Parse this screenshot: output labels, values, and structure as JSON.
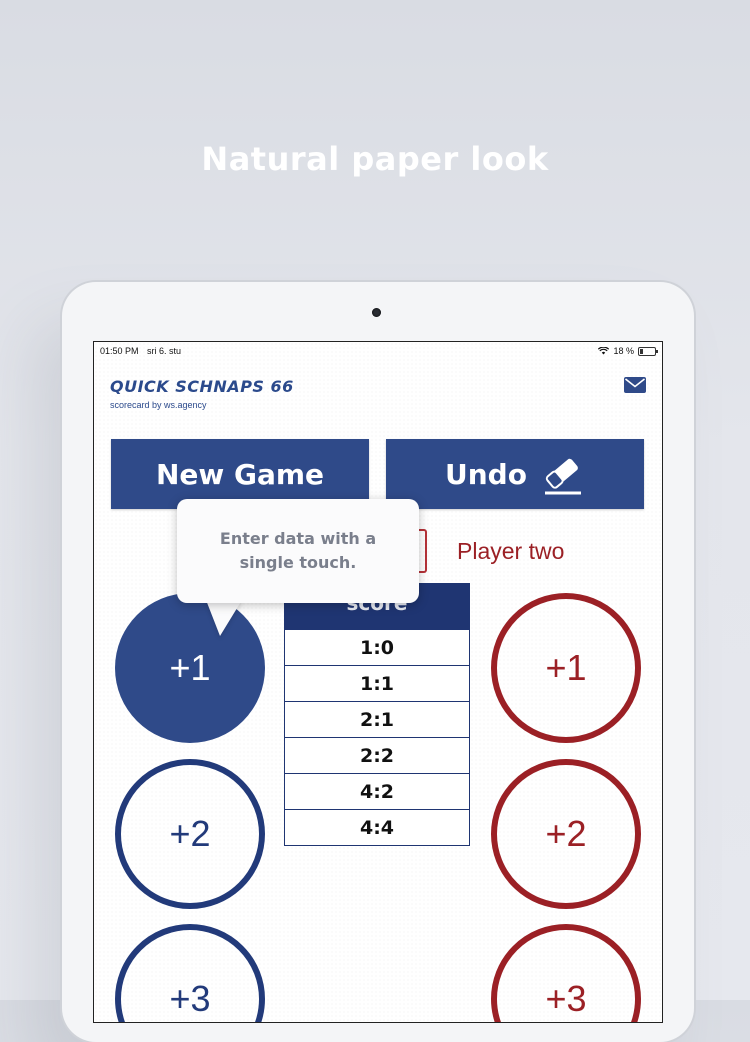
{
  "headline": "Natural paper look",
  "status": {
    "time": "01:50 PM",
    "date": "sri 6. stu",
    "battery": "18 %"
  },
  "app": {
    "title": "QUICK SCHNAPS 66",
    "subtitle": "scorecard by ws.agency"
  },
  "buttons": {
    "new_game": "New Game",
    "undo": "Undo"
  },
  "players": {
    "two": "Player two"
  },
  "tooltip": {
    "line1": "Enter data with a",
    "line2": "single touch."
  },
  "score": {
    "header": "score",
    "rows": [
      "1:0",
      "1:1",
      "2:1",
      "2:2",
      "4:2",
      "4:4"
    ]
  },
  "player_one_buttons": [
    "+1",
    "+2",
    "+3"
  ],
  "player_two_buttons": [
    "+1",
    "+2",
    "+3"
  ],
  "colors": {
    "blue": "#2f4a89",
    "red": "#9b2025"
  }
}
